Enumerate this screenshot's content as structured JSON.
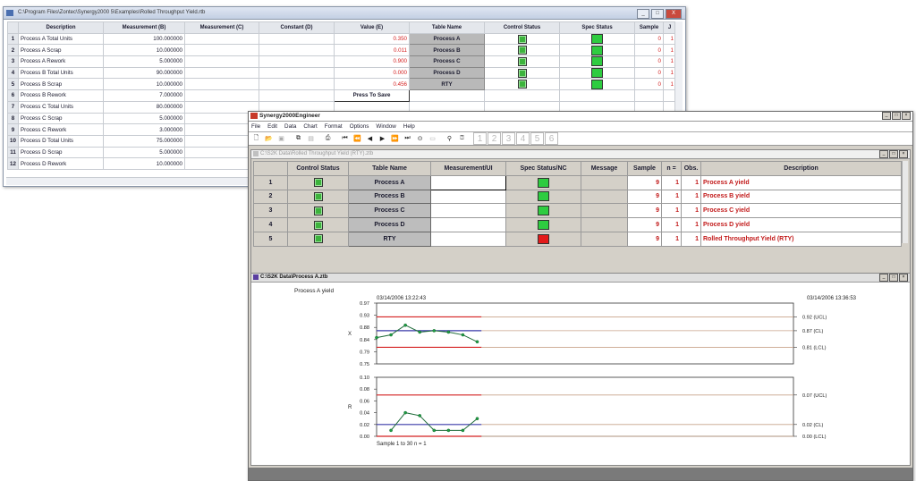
{
  "win1": {
    "title": "C:\\Program Files\\Zontec\\Synergy2000 5\\Examples\\Rolled Throughput Yield.rtb",
    "buttons": [
      "_",
      "□",
      "X"
    ],
    "columns": [
      "Description",
      "Measurement (B)",
      "Measurement (C)",
      "Constant (D)",
      "Value (E)",
      "Table Name",
      "Control Status",
      "Spec Status",
      "Sample",
      "J"
    ],
    "rows": [
      {
        "n": "1",
        "desc": "Process A Total Units",
        "b": "100.000000",
        "e": "0.350",
        "table": "Process A",
        "sample": "0",
        "j": "1"
      },
      {
        "n": "2",
        "desc": "Process A Scrap",
        "b": "10.000000",
        "e": "0.011",
        "table": "Process B",
        "sample": "0",
        "j": "1"
      },
      {
        "n": "3",
        "desc": "Process A Rework",
        "b": "5.000000",
        "e": "0.900",
        "table": "Process C",
        "sample": "0",
        "j": "1"
      },
      {
        "n": "4",
        "desc": "Process B Total Units",
        "b": "90.000000",
        "e": "0.000",
        "table": "Process D",
        "sample": "0",
        "j": "1"
      },
      {
        "n": "5",
        "desc": "Process B Scrap",
        "b": "10.000000",
        "e": "0.456",
        "table": "RTY",
        "sample": "0",
        "j": "1"
      },
      {
        "n": "6",
        "desc": "Process B Rework",
        "b": "7.000000",
        "e": "",
        "table": "",
        "sample": "",
        "j": ""
      },
      {
        "n": "7",
        "desc": "Process C Total Units",
        "b": "80.000000",
        "e": "",
        "table": "",
        "sample": "",
        "j": ""
      },
      {
        "n": "8",
        "desc": "Process C Scrap",
        "b": "5.000000",
        "e": "",
        "table": "",
        "sample": "",
        "j": ""
      },
      {
        "n": "9",
        "desc": "Process C Rework",
        "b": "3.000000",
        "e": "",
        "table": "",
        "sample": "",
        "j": ""
      },
      {
        "n": "10",
        "desc": "Process D Total Units",
        "b": "75.000000",
        "e": "",
        "table": "",
        "sample": "",
        "j": ""
      },
      {
        "n": "11",
        "desc": "Process D Scrap",
        "b": "5.000000",
        "e": "",
        "table": "",
        "sample": "",
        "j": ""
      },
      {
        "n": "12",
        "desc": "Process D Rework",
        "b": "10.000000",
        "e": "",
        "table": "",
        "sample": "",
        "j": ""
      }
    ],
    "press_to_save": "Press To Save"
  },
  "win2": {
    "title": "Synergy2000Engineer",
    "menu": [
      "File",
      "Edit",
      "Data",
      "Chart",
      "Format",
      "Options",
      "Window",
      "Help"
    ],
    "toolbar_pages": [
      "1",
      "2",
      "3",
      "4",
      "5",
      "6"
    ],
    "table_window": {
      "title": "C:\\S2K Data\\Rolled Throughput Yield (RTY).ztb",
      "columns": [
        "",
        "Control Status",
        "Table Name",
        "Measurement/UI",
        "Spec Status/NC",
        "Message",
        "Sample",
        "n =",
        "Obs.",
        "Description"
      ],
      "rows": [
        {
          "n": "1",
          "table": "Process A",
          "sample": "9",
          "nn": "1",
          "obs": "1",
          "desc": "Process A yield",
          "spec": "green"
        },
        {
          "n": "2",
          "table": "Process B",
          "sample": "9",
          "nn": "1",
          "obs": "1",
          "desc": "Process B yield",
          "spec": "green"
        },
        {
          "n": "3",
          "table": "Process C",
          "sample": "9",
          "nn": "1",
          "obs": "1",
          "desc": "Process C yield",
          "spec": "green"
        },
        {
          "n": "4",
          "table": "Process D",
          "sample": "9",
          "nn": "1",
          "obs": "1",
          "desc": "Process D yield",
          "spec": "green"
        },
        {
          "n": "5",
          "table": "RTY",
          "sample": "9",
          "nn": "1",
          "obs": "1",
          "desc": "Rolled Throughput Yield (RTY)",
          "spec": "red"
        }
      ]
    },
    "chart_window": {
      "title": "C:\\S2K Data\\Process A.ztb"
    }
  },
  "chart_data": [
    {
      "type": "line",
      "title": "Process A yield",
      "start_stamp": "03/14/2006  13:22:43",
      "end_stamp": "03/14/2006  13:36:53",
      "ylabel": "X",
      "yticks": [
        "0.97",
        "0.93",
        "0.88",
        "0.84",
        "0.79",
        "0.75"
      ],
      "ylim": [
        0.75,
        0.97
      ],
      "x": [
        1,
        2,
        3,
        4,
        5,
        6,
        7,
        8
      ],
      "values": [
        0.845,
        0.855,
        0.89,
        0.865,
        0.87,
        0.865,
        0.855,
        0.83
      ],
      "xlim": [
        1,
        30
      ],
      "limits": [
        {
          "name": "UCL",
          "value": 0.92,
          "label": "0.92 (UCL)",
          "color": "#d42020"
        },
        {
          "name": "CL",
          "value": 0.87,
          "label": "0.87 (CL)",
          "color": "#3a3aa8"
        },
        {
          "name": "LCL",
          "value": 0.81,
          "label": "0.81 (LCL)",
          "color": "#d42020"
        }
      ],
      "grid": false
    },
    {
      "type": "line",
      "ylabel": "R",
      "yticks": [
        "0.10",
        "0.08",
        "0.06",
        "0.04",
        "0.02",
        "0.00"
      ],
      "ylim": [
        0,
        0.1
      ],
      "x": [
        2,
        3,
        4,
        5,
        6,
        7,
        8
      ],
      "values": [
        0.01,
        0.04,
        0.035,
        0.01,
        0.01,
        0.01,
        0.03
      ],
      "xlim": [
        1,
        30
      ],
      "limits": [
        {
          "name": "UCL",
          "value": 0.07,
          "label": "0.07 (UCL)",
          "color": "#d42020"
        },
        {
          "name": "CL",
          "value": 0.02,
          "label": "0.02 (CL)",
          "color": "#3a3aa8"
        },
        {
          "name": "LCL",
          "value": 0.0,
          "label": "0.00 (LCL)",
          "color": "#d42020"
        }
      ],
      "footer": "Sample  1  to  30   n = 1",
      "grid": false
    }
  ]
}
